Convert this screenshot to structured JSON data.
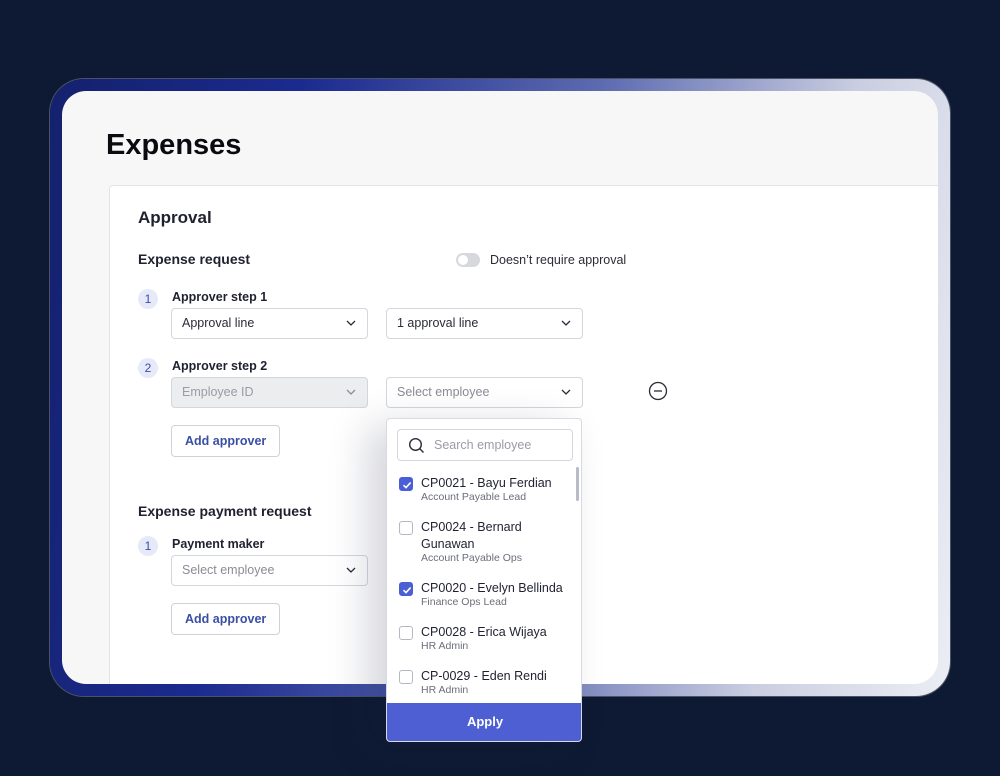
{
  "page": {
    "title": "Expenses"
  },
  "approval": {
    "title": "Approval",
    "expense_request": {
      "title": "Expense request",
      "toggle_label": "Doesn’t require approval",
      "steps": [
        {
          "num": "1",
          "label": "Approver step 1",
          "type_value": "Approval line",
          "target_value": "1 approval line"
        },
        {
          "num": "2",
          "label": "Approver step 2",
          "type_value": "Employee ID",
          "target_placeholder": "Select employee"
        }
      ],
      "add_approver": "Add approver"
    },
    "payment_request": {
      "title": "Expense payment request",
      "steps": [
        {
          "num": "1",
          "label": "Payment maker",
          "placeholder": "Select employee"
        }
      ],
      "add_approver": "Add approver"
    }
  },
  "dropdown": {
    "search_placeholder": "Search employee",
    "items": [
      {
        "name": "CP0021 - Bayu Ferdian",
        "role": "Account Payable Lead",
        "checked": true
      },
      {
        "name": "CP0024 - Bernard Gunawan",
        "role": "Account Payable Ops",
        "checked": false
      },
      {
        "name": "CP0020 - Evelyn Bellinda",
        "role": "Finance Ops Lead",
        "checked": true
      },
      {
        "name": "CP0028 - Erica Wijaya",
        "role": "HR Admin",
        "checked": false
      },
      {
        "name": "CP-0029 - Eden Rendi",
        "role": "HR Admin",
        "checked": false
      }
    ],
    "apply_label": "Apply"
  },
  "colors": {
    "accent": "#4e5fd4",
    "background": "#0e1a33"
  },
  "icons": [
    "chevron-down-icon",
    "remove-circle-icon",
    "search-icon",
    "check-icon"
  ]
}
